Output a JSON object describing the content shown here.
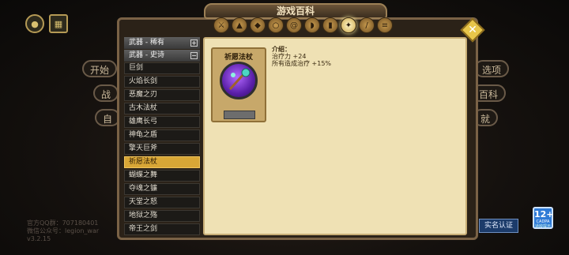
{
  "window": {
    "title": "游戏百科",
    "close_label": "✕"
  },
  "tabs": [
    {
      "icon": "weapon-tab-icon"
    },
    {
      "icon": "armor-tab-icon"
    },
    {
      "icon": "helmet-tab-icon"
    },
    {
      "icon": "ring-tab-icon"
    },
    {
      "icon": "spiral-tab-icon"
    },
    {
      "icon": "cloak-tab-icon"
    },
    {
      "icon": "boot-tab-icon"
    },
    {
      "icon": "compass-tab-icon",
      "active": true
    },
    {
      "icon": "staff-tab-icon"
    },
    {
      "icon": "scroll-tab-icon"
    }
  ],
  "categories": [
    {
      "label": "武器 - 稀有",
      "toggle": "+"
    },
    {
      "label": "武器 - 史诗",
      "toggle": "−"
    }
  ],
  "items": [
    "巨剑",
    "火焰长剑",
    "恶魔之刃",
    "古木法杖",
    "雄鹰长弓",
    "神龟之盾",
    "擎天巨斧",
    "祈愿法杖",
    "蝴蝶之舞",
    "夺魂之镰",
    "天堂之怒",
    "地狱之殇",
    "帝王之剑"
  ],
  "selected_item": "祈愿法杖",
  "detail": {
    "name": "祈愿法杖",
    "intro_heading": "介绍：",
    "lines": [
      "治疗力 +24",
      "所有造成治疗 +15%"
    ]
  },
  "background_buttons": [
    "开始",
    "战",
    "自",
    "选项",
    "百科",
    "就"
  ],
  "footer": {
    "qq": "官方QQ群：707180401",
    "wechat": "微信公众号：legion_war",
    "version": "v3.2.15"
  },
  "age_rating": {
    "number": "12+",
    "label": "CADPA",
    "sub": "适龄提示"
  },
  "realname_button": "实名认证"
}
